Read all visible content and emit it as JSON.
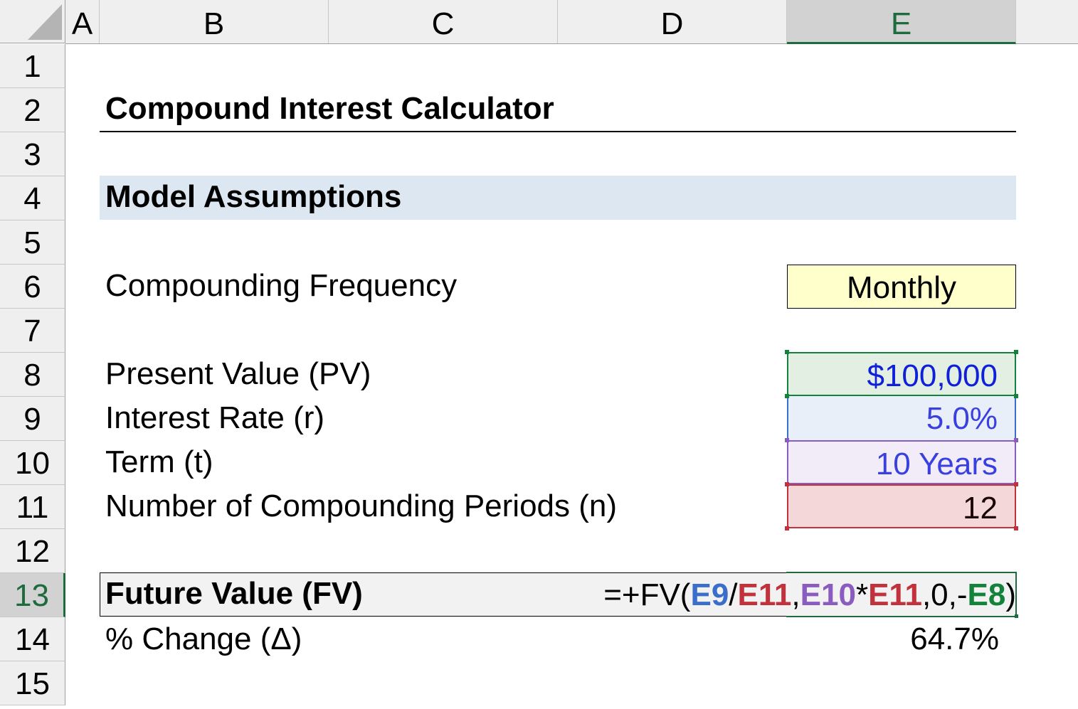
{
  "columns": [
    "A",
    "B",
    "C",
    "D",
    "E"
  ],
  "selected_column": "E",
  "rows": [
    "1",
    "2",
    "3",
    "4",
    "5",
    "6",
    "7",
    "8",
    "9",
    "10",
    "11",
    "12",
    "13",
    "14",
    "15"
  ],
  "selected_row": "13",
  "title": "Compound Interest Calculator",
  "section_header": "Model Assumptions",
  "assumptions": {
    "frequency": {
      "label": "Compounding Frequency",
      "value": "Monthly"
    },
    "present_value": {
      "label": "Present Value (PV)",
      "value": "$100,000"
    },
    "interest_rate": {
      "label": "Interest Rate (r)",
      "value": "5.0%"
    },
    "term": {
      "label": "Term (t)",
      "value": "10 Years"
    },
    "periods": {
      "label": "Number of Compounding Periods (n)",
      "value": "12"
    }
  },
  "output": {
    "fv_label": "Future Value (FV)",
    "formula": {
      "prefix": "=+FV(",
      "ref1": "E9",
      "op1": "/",
      "ref2": "E11",
      "sep1": ",",
      "ref3": "E10",
      "op2": "*",
      "ref4": "E11",
      "sep2": ",0,-",
      "ref5": "E8",
      "suffix": ")"
    },
    "change_label": "% Change (Δ)",
    "change_value": "64.7%"
  },
  "colors": {
    "ref_e9": "#3a6fc9",
    "ref_e11": "#c0323c",
    "ref_e10": "#8a5cc0",
    "ref_e8": "#13823a",
    "input_blue": "#2a2fd6"
  }
}
